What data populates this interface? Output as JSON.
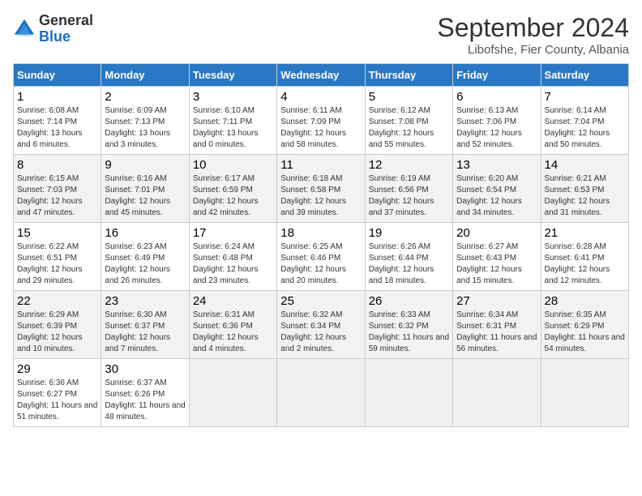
{
  "header": {
    "logo_general": "General",
    "logo_blue": "Blue",
    "month_year": "September 2024",
    "location": "Libofshe, Fier County, Albania"
  },
  "columns": [
    "Sunday",
    "Monday",
    "Tuesday",
    "Wednesday",
    "Thursday",
    "Friday",
    "Saturday"
  ],
  "weeks": [
    [
      {
        "day": "1",
        "info": "Sunrise: 6:08 AM\nSunset: 7:14 PM\nDaylight: 13 hours and 6 minutes."
      },
      {
        "day": "2",
        "info": "Sunrise: 6:09 AM\nSunset: 7:13 PM\nDaylight: 13 hours and 3 minutes."
      },
      {
        "day": "3",
        "info": "Sunrise: 6:10 AM\nSunset: 7:11 PM\nDaylight: 13 hours and 0 minutes."
      },
      {
        "day": "4",
        "info": "Sunrise: 6:11 AM\nSunset: 7:09 PM\nDaylight: 12 hours and 58 minutes."
      },
      {
        "day": "5",
        "info": "Sunrise: 6:12 AM\nSunset: 7:08 PM\nDaylight: 12 hours and 55 minutes."
      },
      {
        "day": "6",
        "info": "Sunrise: 6:13 AM\nSunset: 7:06 PM\nDaylight: 12 hours and 52 minutes."
      },
      {
        "day": "7",
        "info": "Sunrise: 6:14 AM\nSunset: 7:04 PM\nDaylight: 12 hours and 50 minutes."
      }
    ],
    [
      {
        "day": "8",
        "info": "Sunrise: 6:15 AM\nSunset: 7:03 PM\nDaylight: 12 hours and 47 minutes."
      },
      {
        "day": "9",
        "info": "Sunrise: 6:16 AM\nSunset: 7:01 PM\nDaylight: 12 hours and 45 minutes."
      },
      {
        "day": "10",
        "info": "Sunrise: 6:17 AM\nSunset: 6:59 PM\nDaylight: 12 hours and 42 minutes."
      },
      {
        "day": "11",
        "info": "Sunrise: 6:18 AM\nSunset: 6:58 PM\nDaylight: 12 hours and 39 minutes."
      },
      {
        "day": "12",
        "info": "Sunrise: 6:19 AM\nSunset: 6:56 PM\nDaylight: 12 hours and 37 minutes."
      },
      {
        "day": "13",
        "info": "Sunrise: 6:20 AM\nSunset: 6:54 PM\nDaylight: 12 hours and 34 minutes."
      },
      {
        "day": "14",
        "info": "Sunrise: 6:21 AM\nSunset: 6:53 PM\nDaylight: 12 hours and 31 minutes."
      }
    ],
    [
      {
        "day": "15",
        "info": "Sunrise: 6:22 AM\nSunset: 6:51 PM\nDaylight: 12 hours and 29 minutes."
      },
      {
        "day": "16",
        "info": "Sunrise: 6:23 AM\nSunset: 6:49 PM\nDaylight: 12 hours and 26 minutes."
      },
      {
        "day": "17",
        "info": "Sunrise: 6:24 AM\nSunset: 6:48 PM\nDaylight: 12 hours and 23 minutes."
      },
      {
        "day": "18",
        "info": "Sunrise: 6:25 AM\nSunset: 6:46 PM\nDaylight: 12 hours and 20 minutes."
      },
      {
        "day": "19",
        "info": "Sunrise: 6:26 AM\nSunset: 6:44 PM\nDaylight: 12 hours and 18 minutes."
      },
      {
        "day": "20",
        "info": "Sunrise: 6:27 AM\nSunset: 6:43 PM\nDaylight: 12 hours and 15 minutes."
      },
      {
        "day": "21",
        "info": "Sunrise: 6:28 AM\nSunset: 6:41 PM\nDaylight: 12 hours and 12 minutes."
      }
    ],
    [
      {
        "day": "22",
        "info": "Sunrise: 6:29 AM\nSunset: 6:39 PM\nDaylight: 12 hours and 10 minutes."
      },
      {
        "day": "23",
        "info": "Sunrise: 6:30 AM\nSunset: 6:37 PM\nDaylight: 12 hours and 7 minutes."
      },
      {
        "day": "24",
        "info": "Sunrise: 6:31 AM\nSunset: 6:36 PM\nDaylight: 12 hours and 4 minutes."
      },
      {
        "day": "25",
        "info": "Sunrise: 6:32 AM\nSunset: 6:34 PM\nDaylight: 12 hours and 2 minutes."
      },
      {
        "day": "26",
        "info": "Sunrise: 6:33 AM\nSunset: 6:32 PM\nDaylight: 11 hours and 59 minutes."
      },
      {
        "day": "27",
        "info": "Sunrise: 6:34 AM\nSunset: 6:31 PM\nDaylight: 11 hours and 56 minutes."
      },
      {
        "day": "28",
        "info": "Sunrise: 6:35 AM\nSunset: 6:29 PM\nDaylight: 11 hours and 54 minutes."
      }
    ],
    [
      {
        "day": "29",
        "info": "Sunrise: 6:36 AM\nSunset: 6:27 PM\nDaylight: 11 hours and 51 minutes."
      },
      {
        "day": "30",
        "info": "Sunrise: 6:37 AM\nSunset: 6:26 PM\nDaylight: 11 hours and 48 minutes."
      },
      {
        "day": "",
        "info": ""
      },
      {
        "day": "",
        "info": ""
      },
      {
        "day": "",
        "info": ""
      },
      {
        "day": "",
        "info": ""
      },
      {
        "day": "",
        "info": ""
      }
    ]
  ]
}
